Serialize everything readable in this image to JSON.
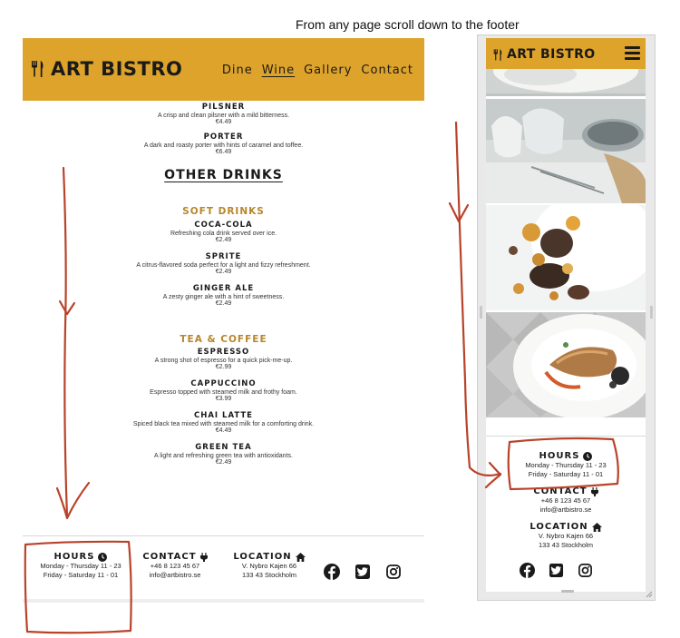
{
  "caption": "From any page scroll down to the footer",
  "brand": "ART BISTRO",
  "nav": {
    "items": [
      "Dine",
      "Wine",
      "Gallery",
      "Contact"
    ],
    "active_index": 1
  },
  "menu": {
    "beers": [
      {
        "name": "PILSNER",
        "desc": "A crisp and clean pilsner with a mild bitterness.",
        "price": "€4.49"
      },
      {
        "name": "PORTER",
        "desc": "A dark and roasty porter with hints of caramel and toffee.",
        "price": "€6.49"
      }
    ],
    "section_title": "OTHER DRINKS",
    "soft_drinks_title": "SOFT DRINKS",
    "soft_drinks": [
      {
        "name": "COCA-COLA",
        "desc": "Refreshing cola drink served over ice.",
        "price": "€2.49"
      },
      {
        "name": "SPRITE",
        "desc": "A citrus-flavored soda perfect for a light and fizzy refreshment.",
        "price": "€2.49"
      },
      {
        "name": "GINGER ALE",
        "desc": "A zesty ginger ale with a hint of sweetness.",
        "price": "€2.49"
      }
    ],
    "tea_coffee_title": "TEA & COFFEE",
    "tea_coffee": [
      {
        "name": "ESPRESSO",
        "desc": "A strong shot of espresso for a quick pick-me-up.",
        "price": "€2.99"
      },
      {
        "name": "CAPPUCCINO",
        "desc": "Espresso topped with steamed milk and frothy foam.",
        "price": "€3.99"
      },
      {
        "name": "CHAI LATTE",
        "desc": "Spiced black tea mixed with steamed milk for a comforting drink.",
        "price": "€4.49"
      },
      {
        "name": "GREEN TEA",
        "desc": "A light and refreshing green tea with antioxidants.",
        "price": "€2.49"
      }
    ]
  },
  "footer": {
    "hours": {
      "title": "HOURS",
      "line1": "Monday - Thursday 11 - 23",
      "line2": "Friday - Saturday 11 - 01"
    },
    "contact": {
      "title": "CONTACT",
      "phone": "+46 8 123 45 67",
      "email": "info@artbistro.se"
    },
    "location": {
      "title": "LOCATION",
      "street": "V. Nybro Kajen 66",
      "city": "133 43 Stockholm"
    },
    "social": [
      "facebook-icon",
      "twitter-icon",
      "instagram-icon"
    ]
  },
  "colors": {
    "header": "#dea32a",
    "accent_heading": "#b7862a",
    "annotation": "#b8432a"
  }
}
